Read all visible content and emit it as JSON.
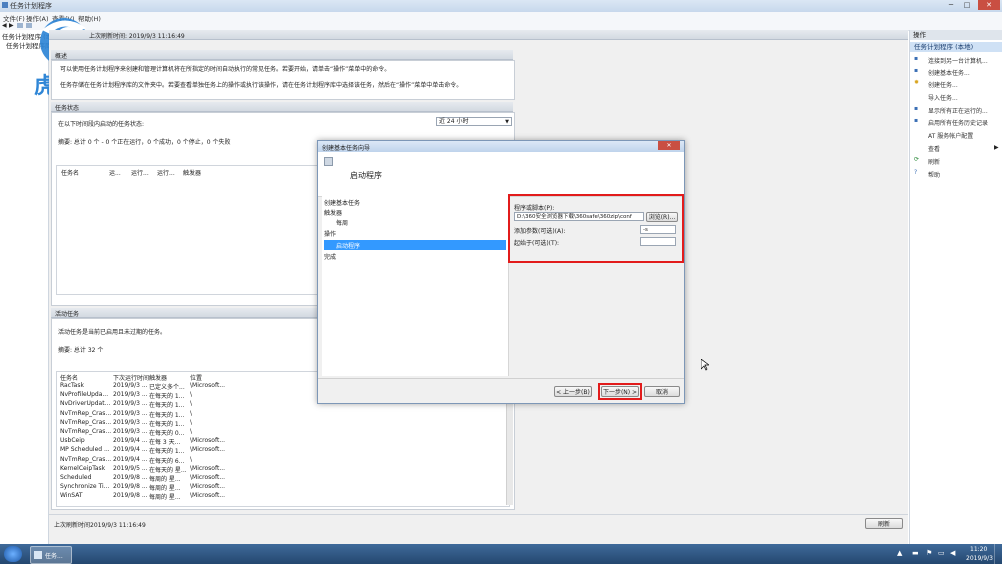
{
  "window": {
    "title": "任务计划程序"
  },
  "menu": [
    "文件(F)",
    "操作(A)",
    "查看(V)",
    "帮助(H)"
  ],
  "tree": {
    "root": "任务计划程序 (本地)",
    "child": "任务计划程序库"
  },
  "overview": {
    "header_text": "概述",
    "last_refresh_header": "上次刷新时间: 2019/9/3 11:16:49",
    "desc_line1": "可以使用任务计划程序来创建和管理计算机将在所指定的时间自动执行的常见任务。若要开始，请单击“操作”菜单中的命令。",
    "desc_line2": "任务存储在任务计划程序库的文件夹中。若要查看单独任务上的操作或执行该操作，请在任务计划程序库中选择该任务，然后在“操作”菜单中单击命令。"
  },
  "task_status": {
    "header": "任务状态",
    "prompt": "在以下时间段内启动的任务状态:",
    "period": "近 24 小时",
    "summary": "摘要: 总计 0 个 - 0 个正在运行，0 个成功，0 个停止，0 个失败",
    "columns": [
      "任务名",
      "运...",
      "运行...",
      "运行...",
      "触发器"
    ]
  },
  "active_tasks": {
    "header": "活动任务",
    "desc": "活动任务是当前已启用且未过期的任务。",
    "summary": "摘要: 总计 32 个",
    "columns": [
      "任务名",
      "下次运行时间",
      "触发器",
      "位置"
    ],
    "rows": [
      [
        "RacTask",
        "2019/9/3 ...",
        "已定义多个...",
        "\\Microsoft..."
      ],
      [
        "NvProfileUpda...",
        "2019/9/3 ...",
        "在每天的 1...",
        "\\"
      ],
      [
        "NvDriverUpdat...",
        "2019/9/3 ...",
        "在每天的 1...",
        "\\"
      ],
      [
        "NvTmRep_Cras...",
        "2019/9/3 ...",
        "在每天的 1...",
        "\\"
      ],
      [
        "NvTmRep_Cras...",
        "2019/9/3 ...",
        "在每天的 1...",
        "\\"
      ],
      [
        "NvTmRep_Cras...",
        "2019/9/3 ...",
        "在每天的 0...",
        "\\"
      ],
      [
        "UsbCeip",
        "2019/9/4 ...",
        "在每 3 天...",
        "\\Microsoft..."
      ],
      [
        "MP Scheduled ...",
        "2019/9/4 ...",
        "在每天的 1...",
        "\\Microsoft..."
      ],
      [
        "NvTmRep_Cras...",
        "2019/9/4 ...",
        "在每天的 6...",
        "\\"
      ],
      [
        "KernelCeipTask",
        "2019/9/5 ...",
        "在每天的 星...",
        "\\Microsoft..."
      ],
      [
        "Scheduled",
        "2019/9/8 ...",
        "每周的 星...",
        "\\Microsoft..."
      ],
      [
        "Synchronize Ti...",
        "2019/9/8 ...",
        "每周的 星...",
        "\\Microsoft..."
      ],
      [
        "WinSAT",
        "2019/9/8 ...",
        "每周的 星...",
        "\\Microsoft..."
      ]
    ]
  },
  "status_bar": {
    "last_refresh": "上次刷新时间2019/9/3 11:16:49",
    "refresh_button": "刷新"
  },
  "actions_pane": {
    "header": "操作",
    "selected": "任务计划程序 (本地)",
    "items": [
      "连接到另一台计算机...",
      "创建基本任务...",
      "创建任务...",
      "导入任务...",
      "显示所有正在运行的...",
      "启用所有任务历史记录",
      "AT 服务帐户配置",
      "查看",
      "刷新",
      "帮助"
    ]
  },
  "dialog": {
    "title": "创建基本任务向导",
    "heading": "启动程序",
    "steps": [
      "创建基本任务",
      "触发器",
      "每周",
      "操作",
      "启动程序",
      "完成"
    ],
    "selected_step_index": 4,
    "program_label": "程序或脚本(P):",
    "program_value": "D:\\360安全浏览器下载\\360safe\\360zip\\conf",
    "browse_button": "浏览(R)...",
    "args_label": "添加参数(可选)(A):",
    "args_value": "-s",
    "start_label": "起始于(可选)(T):",
    "start_value": "",
    "back_button": "< 上一步(B)",
    "next_button": "下一步(N) >",
    "cancel_button": "取消"
  },
  "watermark": {
    "text": "虎观"
  },
  "taskbar": {
    "task_label": "任务...",
    "time": "11:20",
    "date": "2019/9/3"
  },
  "colors": {
    "highlight": "#e21b1b",
    "selection": "#3399ff",
    "taskbar": "#2f5680"
  }
}
